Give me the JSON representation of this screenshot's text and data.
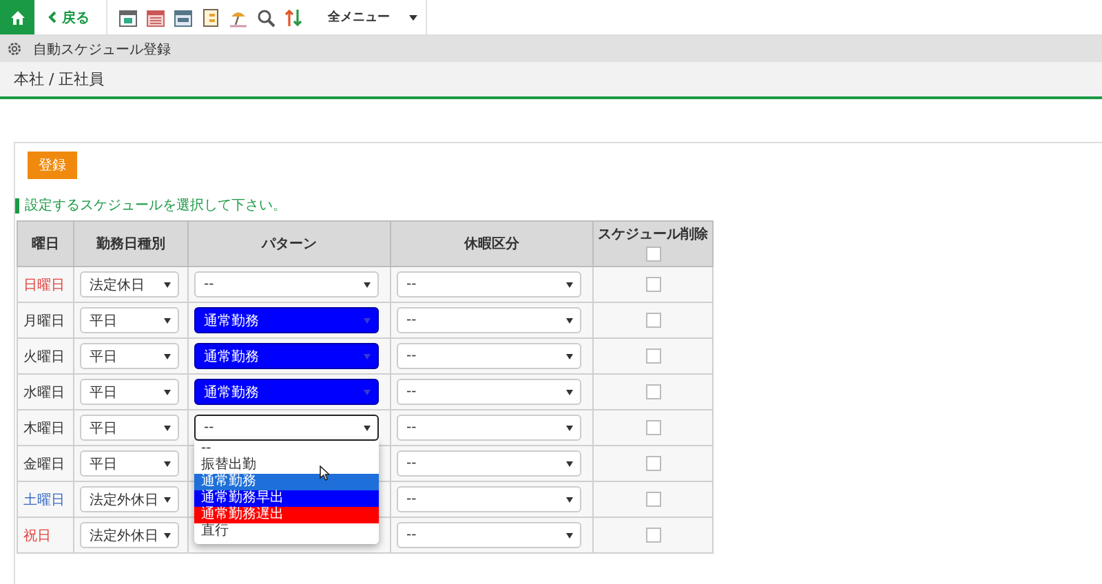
{
  "toolbar": {
    "back": "戻る",
    "menu": "全メニュー"
  },
  "page_title": "自動スケジュール登録",
  "breadcrumb": "本社 / 正社員",
  "register_button": "登録",
  "instruction": "設定するスケジュールを選択して下さい。",
  "table": {
    "columns": [
      "曜日",
      "勤務日種別",
      "パターン",
      "休暇区分",
      "スケジュール削除"
    ],
    "select_all_checked": false,
    "rows": [
      {
        "day": "日曜日",
        "color": "#e0433f",
        "work_type": "法定休日",
        "pattern": {
          "value": "--",
          "focused": false
        },
        "leave": "--",
        "delete_checked": false
      },
      {
        "day": "月曜日",
        "color": "#333333",
        "work_type": "平日",
        "pattern": {
          "value": "通常勤務",
          "color": "#0000ff",
          "focused": false
        },
        "leave": "--",
        "delete_checked": false
      },
      {
        "day": "火曜日",
        "color": "#333333",
        "work_type": "平日",
        "pattern": {
          "value": "通常勤務",
          "color": "#0000ff",
          "focused": false
        },
        "leave": "--",
        "delete_checked": false
      },
      {
        "day": "水曜日",
        "color": "#333333",
        "work_type": "平日",
        "pattern": {
          "value": "通常勤務",
          "color": "#0000ff",
          "focused": false
        },
        "leave": "--",
        "delete_checked": false
      },
      {
        "day": "木曜日",
        "color": "#333333",
        "work_type": "平日",
        "pattern": {
          "value": "--",
          "focused": true,
          "expanded": true,
          "options": [
            {
              "label": "--",
              "highlighted": false
            },
            {
              "label": "振替出勤",
              "highlighted": false
            },
            {
              "label": "通常勤務",
              "highlighted": true
            },
            {
              "label": "通常勤務早出",
              "color": "#0000ff",
              "highlighted": false
            },
            {
              "label": "通常勤務遅出",
              "color": "#ff0000",
              "highlighted": false
            },
            {
              "label": "直行",
              "highlighted": false
            }
          ]
        },
        "leave": "--",
        "delete_checked": false
      },
      {
        "day": "金曜日",
        "color": "#333333",
        "work_type": "平日",
        "leave": "--",
        "delete_checked": false
      },
      {
        "day": "土曜日",
        "color": "#3a6bc4",
        "work_type": "法定外休日",
        "leave": "--",
        "delete_checked": false
      },
      {
        "day": "祝日",
        "color": "#e0433f",
        "work_type": "法定外休日",
        "leave": "--",
        "delete_checked": false
      }
    ]
  }
}
